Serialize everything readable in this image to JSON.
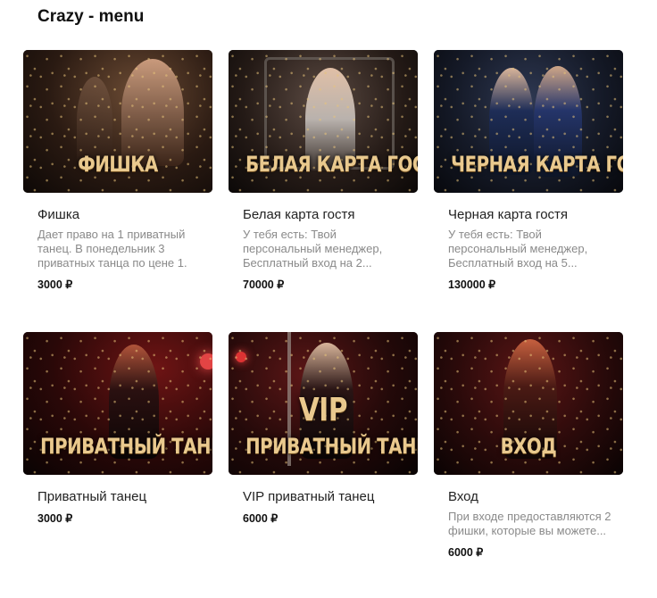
{
  "page": {
    "title": "Crazy - menu"
  },
  "cards": [
    {
      "caption": "ФИШКА",
      "title": "Фишка",
      "desc": "Дает право на 1 приватный танец. В понедельник 3 приватных танца по цене 1.",
      "price": "3000 ₽"
    },
    {
      "caption": "БЕЛАЯ КАРТА ГОСТЯ",
      "title": "Белая карта гостя",
      "desc": "У тебя есть: Твой персональный менеджер, Бесплатный вход на 2...",
      "price": "70000 ₽"
    },
    {
      "caption": "ЧЕРНАЯ КАРТА ГОСТЯ",
      "title": "Черная карта гостя",
      "desc": "У тебя есть: Твой персональный менеджер, Бесплатный вход на 5...",
      "price": "130000 ₽"
    },
    {
      "caption": "ПРИВАТНЫЙ ТАНЕЦ",
      "title": "Приватный танец",
      "desc": "",
      "price": "3000 ₽"
    },
    {
      "caption_top": "VIP",
      "caption": "ПРИВАТНЫЙ ТАНЕЦ",
      "title": "VIP приватный танец",
      "desc": "",
      "price": "6000 ₽"
    },
    {
      "caption": "ВХОД",
      "title": "Вход",
      "desc": "При входе предоставляются 2 фишки, которые вы можете...",
      "price": "6000 ₽"
    }
  ]
}
